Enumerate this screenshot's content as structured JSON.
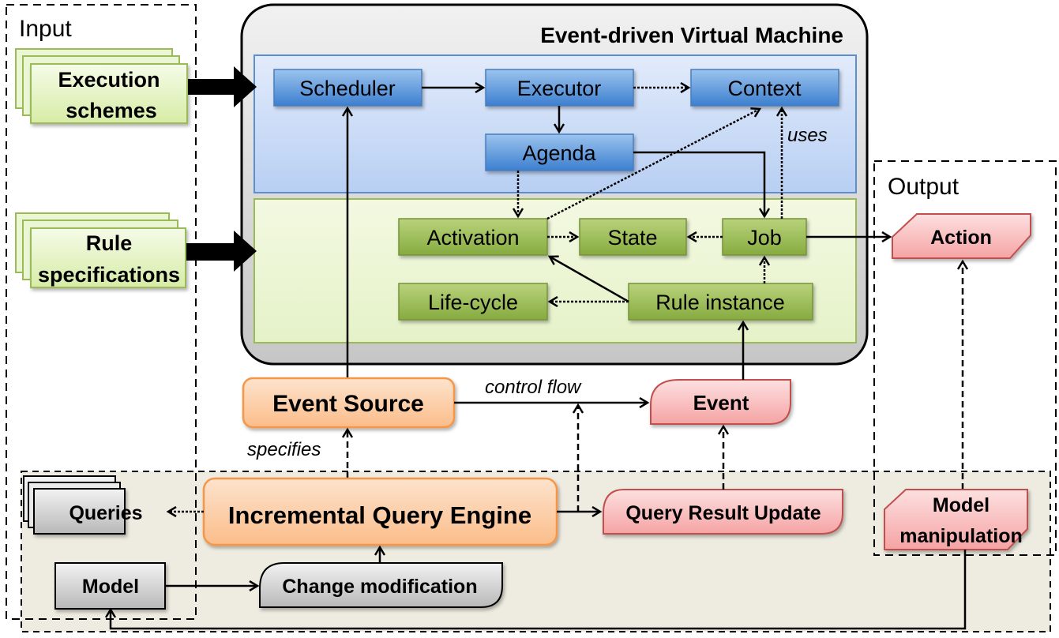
{
  "regions": {
    "input": "Input",
    "output": "Output",
    "vm_title": "Event-driven Virtual Machine"
  },
  "inputs": {
    "execution_schemes": [
      "Execution",
      "schemes"
    ],
    "rule_specifications": [
      "Rule",
      "specifications"
    ]
  },
  "vm_blue": {
    "scheduler": "Scheduler",
    "executor": "Executor",
    "context": "Context",
    "agenda": "Agenda"
  },
  "vm_green": {
    "activation": "Activation",
    "state": "State",
    "job": "Job",
    "life_cycle": "Life-cycle",
    "rule_instance": "Rule instance"
  },
  "flow": {
    "event_source": "Event Source",
    "event": "Event",
    "action": "Action",
    "incremental_query_engine": "Incremental Query Engine",
    "query_result_update": "Query Result Update",
    "queries": "Queries",
    "model": "Model",
    "change_modification": "Change modification",
    "model_manipulation": [
      "Model",
      "manipulation"
    ]
  },
  "edge_labels": {
    "uses": "uses",
    "control_flow": "control flow",
    "specifies": "specifies"
  },
  "colors": {
    "blue_box": "#5b9bd5",
    "green_box": "#9bbb59",
    "orange_box": "#f79646",
    "red_box": "#e6787a",
    "gray_box": "#c8c8c8",
    "vm_panel": "#e3e3e3",
    "bottom_panel": "#eeebe0"
  }
}
